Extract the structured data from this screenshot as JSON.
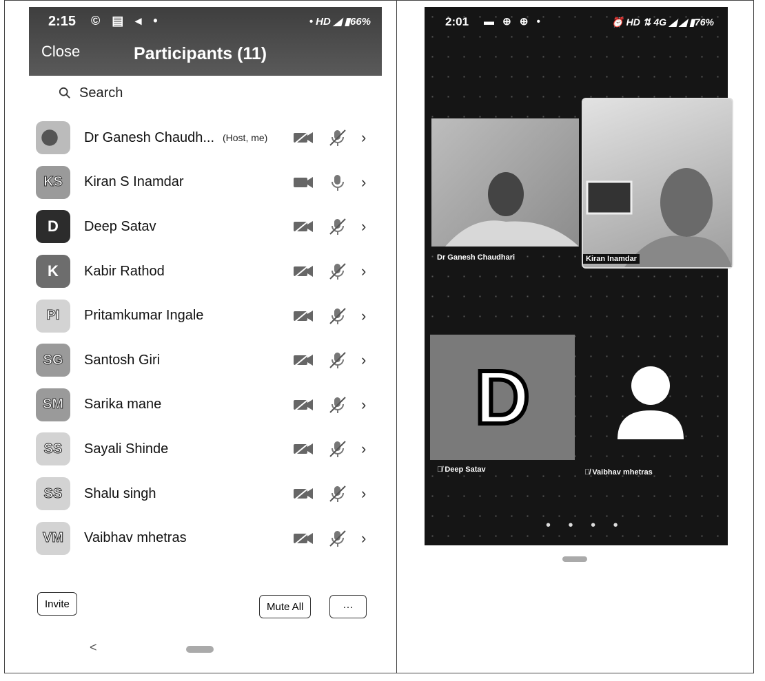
{
  "left": {
    "status": {
      "time": "2:15",
      "icons": "© ▤ ◂ •",
      "right": "• HD ◢ ▮66%"
    },
    "close_label": "Close",
    "title": "Participants (11)",
    "search_placeholder": "Search",
    "participants": [
      {
        "initials": "",
        "name": "Dr Ganesh Chaudh...",
        "tag": "(Host, me)"
      },
      {
        "initials": "KS",
        "name": "Kiran S Inamdar",
        "tag": ""
      },
      {
        "initials": "D",
        "name": "Deep Satav",
        "tag": ""
      },
      {
        "initials": "K",
        "name": "Kabir Rathod",
        "tag": ""
      },
      {
        "initials": "PI",
        "name": "Pritamkumar Ingale",
        "tag": ""
      },
      {
        "initials": "SG",
        "name": "Santosh Giri",
        "tag": ""
      },
      {
        "initials": "SM",
        "name": "Sarika mane",
        "tag": ""
      },
      {
        "initials": "SS",
        "name": "Sayali Shinde",
        "tag": ""
      },
      {
        "initials": "SS",
        "name": "Shalu singh",
        "tag": ""
      },
      {
        "initials": "VM",
        "name": "Vaibhav mhetras",
        "tag": ""
      }
    ],
    "invite_label": "Invite",
    "mute_all_label": "Mute All",
    "more_label": "···",
    "back_label": "<"
  },
  "right": {
    "status": {
      "time": "2:01",
      "icons": "▬ ⊕ ⊕ •",
      "right": "⏰ HD ⇅ 4G ◢ ◢ ▮76%"
    },
    "tiles": {
      "ganesh": "Dr Ganesh Chaudhari",
      "kiran": "Kiran Inamdar",
      "deep_letter": "D",
      "deep": "Deep Satav",
      "vaibhav": "Vaibhav mhetras"
    },
    "page_dots": "• • • •"
  }
}
